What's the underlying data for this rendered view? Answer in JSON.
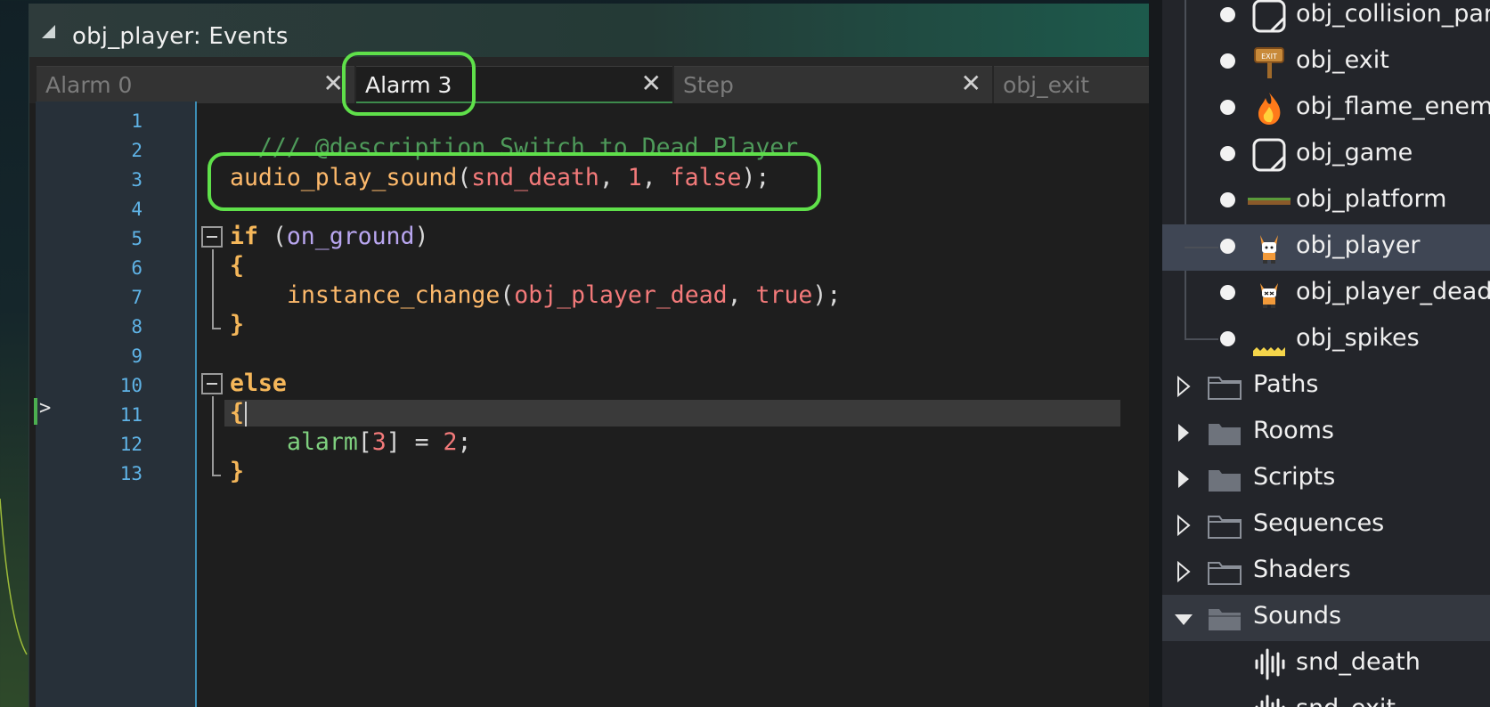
{
  "editor": {
    "title": "obj_player: Events",
    "tabs": [
      {
        "label": "Alarm 0",
        "active": false,
        "closable": true
      },
      {
        "label": "Alarm 3",
        "active": true,
        "closable": true
      },
      {
        "label": "Step",
        "active": false,
        "closable": true
      },
      {
        "label": "obj_exit",
        "active": false,
        "closable": false
      }
    ],
    "line_numbers": [
      "1",
      "2",
      "3",
      "4",
      "5",
      "6",
      "7",
      "8",
      "9",
      "10",
      "11",
      "12",
      "13"
    ],
    "current_line": 11,
    "code": {
      "l1": "/// @description Switch to Dead Player",
      "l3_func": "audio_play_sound",
      "l3_p1": "(",
      "l3_arg1": "snd_death",
      "l3_c1": ", ",
      "l3_arg2": "1",
      "l3_c2": ", ",
      "l3_arg3": "false",
      "l3_end": ");",
      "l5_kw": "if",
      "l5_p1": " (",
      "l5_var": "on_ground",
      "l5_p2": ")",
      "l6": "{",
      "l7_func": "instance_change",
      "l7_p1": "(",
      "l7_arg1": "obj_player_dead",
      "l7_c1": ", ",
      "l7_arg2": "true",
      "l7_end": ");",
      "l8": "}",
      "l10_kw": "else",
      "l11": "{",
      "l12_var": "alarm",
      "l12_b1": "[",
      "l12_idx": "3",
      "l12_b2": "] = ",
      "l12_val": "2",
      "l12_end": ";",
      "l13": "}"
    }
  },
  "asset_browser": {
    "objects": [
      {
        "label": "obj_collision_par",
        "icon": "square-sprite-icon"
      },
      {
        "label": "obj_exit",
        "icon": "exit-sign-icon"
      },
      {
        "label": "obj_flame_enemy",
        "icon": "flame-icon"
      },
      {
        "label": "obj_game",
        "icon": "square-sprite-icon"
      },
      {
        "label": "obj_platform",
        "icon": "platform-sprite-icon"
      },
      {
        "label": "obj_player",
        "icon": "player-sprite-icon",
        "selected": true
      },
      {
        "label": "obj_player_dead",
        "icon": "player-dead-sprite-icon"
      },
      {
        "label": "obj_spikes",
        "icon": "spikes-sprite-icon"
      }
    ],
    "folders": [
      {
        "label": "Paths",
        "expanded": false
      },
      {
        "label": "Rooms",
        "expanded": false
      },
      {
        "label": "Scripts",
        "expanded": false
      },
      {
        "label": "Sequences",
        "expanded": false
      },
      {
        "label": "Shaders",
        "expanded": false
      },
      {
        "label": "Sounds",
        "expanded": true
      }
    ],
    "sounds": [
      {
        "label": "snd_death",
        "icon": "sound-wave-icon"
      },
      {
        "label": "snd_exit",
        "icon": "sound-wave-icon"
      }
    ]
  },
  "colors": {
    "highlight": "#5fe04a",
    "comment": "#4e9a5a",
    "function": "#fdb96b",
    "keyword": "#f5b75a",
    "resource": "#f37a7a",
    "variable": "#b9a6f0",
    "builtin": "#7fd07f",
    "line_number": "#5fb3e6"
  }
}
